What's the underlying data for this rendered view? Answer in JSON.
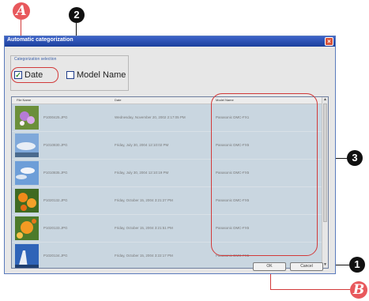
{
  "callouts": {
    "a": "A",
    "b": "B",
    "n1": "1",
    "n2": "2",
    "n3": "3"
  },
  "dialog": {
    "title": "Automatic categorization",
    "close_glyph": "×",
    "group_label": "Categorization selection",
    "options": [
      {
        "label": "Date",
        "checked": true,
        "check_glyph": "✓"
      },
      {
        "label": "Model Name",
        "checked": false,
        "check_glyph": ""
      }
    ],
    "columns": [
      "File Name",
      "Date",
      "Model Name"
    ],
    "rows": [
      {
        "file": "P1000425.JPG",
        "date": "Wednesday, November 20, 2002 2:17:05 PM",
        "model": "Panasonic DMC-FX1"
      },
      {
        "file": "P1010830.JPG",
        "date": "Friday, July 30, 2004 12:10:02 PM",
        "model": "Panasonic DMC-FX5"
      },
      {
        "file": "P1010835.JPG",
        "date": "Friday, July 30, 2004 12:10:19 PM",
        "model": "Panasonic DMC-FX5"
      },
      {
        "file": "P1020132.JPG",
        "date": "Friday, October 15, 2004 3:21:27 PM",
        "model": "Panasonic DMC-FX5"
      },
      {
        "file": "P1020133.JPG",
        "date": "Friday, October 15, 2004 3:21:51 PM",
        "model": "Panasonic DMC-FX5"
      },
      {
        "file": "P1020134.JPG",
        "date": "Friday, October 15, 2004 3:22:17 PM",
        "model": "Panasonic DMC-FX5"
      }
    ],
    "ok_label": "OK",
    "cancel_label": "Cancel"
  }
}
